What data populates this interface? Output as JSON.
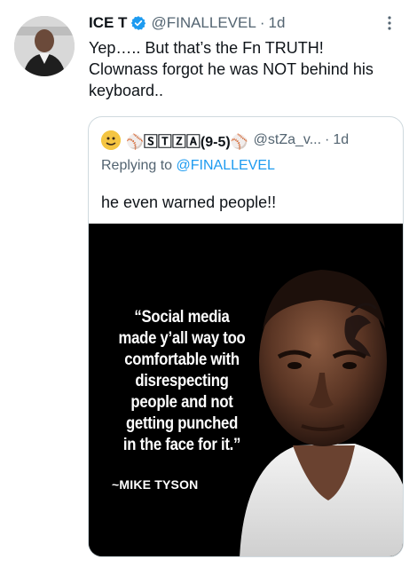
{
  "tweet": {
    "author_name": "ICE T",
    "handle": "@FINALLEVEL",
    "separator": "·",
    "time": "1d",
    "text_lines": [
      "Yep….. But that’s the Fn TRUTH!",
      "Clownass forgot he was NOT behind his",
      "keyboard.."
    ],
    "verified_icon": "verified-badge-icon",
    "more_icon": "more-options-icon",
    "colors": {
      "verified": "#1d9bf0",
      "secondary_text": "#536471",
      "link": "#1d9bf0",
      "border": "#cfd9de"
    }
  },
  "quote": {
    "display_name": "⚾️🅂🅃🅉🄰(9-5)⚾️",
    "name_main": "STZA(9-5)",
    "handle": "@stZa_v...",
    "separator": "·",
    "time": "1d",
    "replying_prefix": "Replying to",
    "replying_handle": "@FINALLEVEL",
    "text": "he even warned people!!",
    "media": {
      "quote_lines": [
        "“Social media",
        "made y’all way too",
        "comfortable with",
        "disrespecting",
        "people and not",
        "getting punched",
        "in the face for it.”"
      ],
      "attribution": "~MIKE TYSON"
    }
  }
}
